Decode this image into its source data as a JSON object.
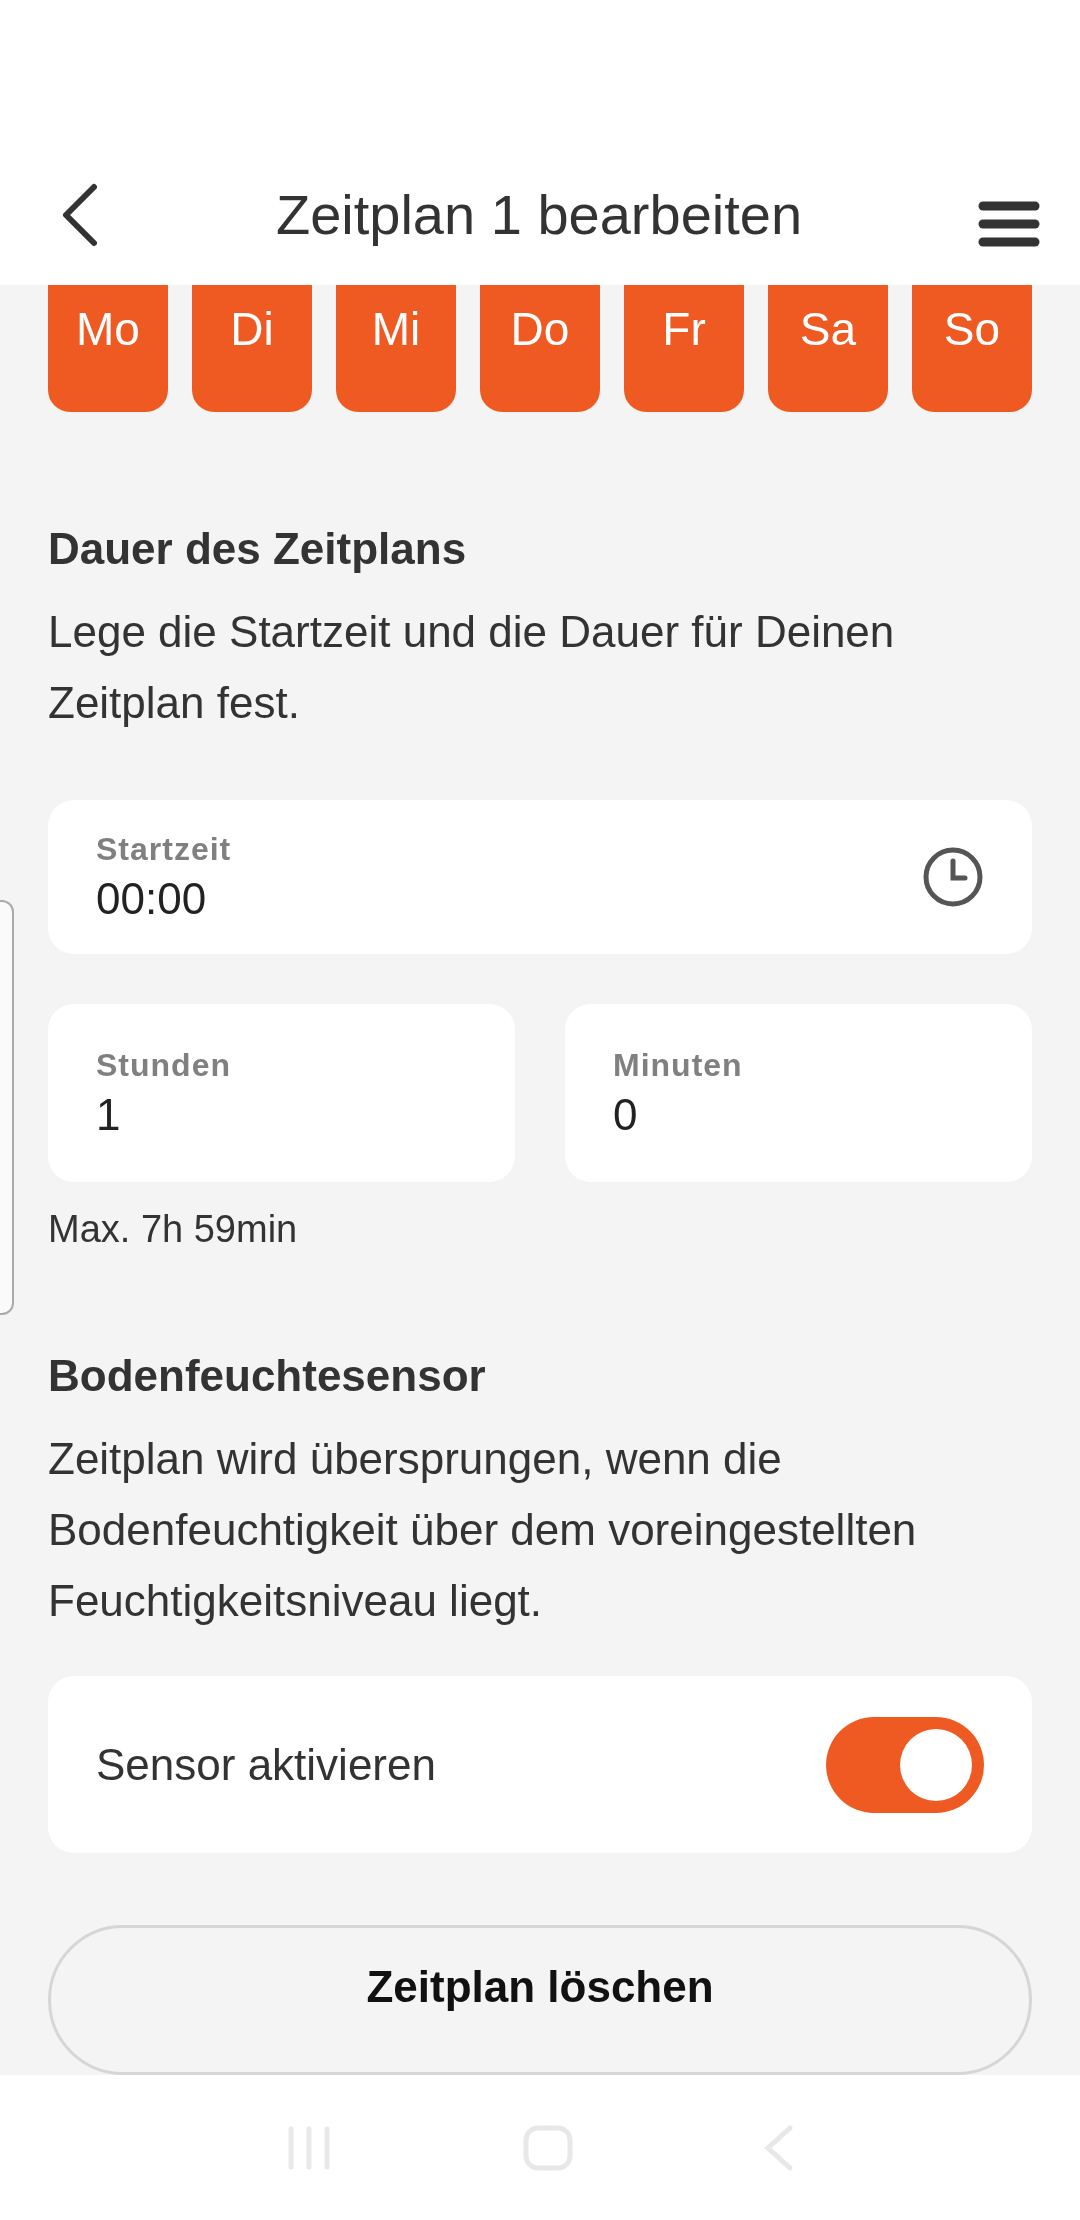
{
  "header": {
    "title": "Zeitplan 1 bearbeiten"
  },
  "days": [
    {
      "label": "Mo",
      "selected": true
    },
    {
      "label": "Di",
      "selected": true
    },
    {
      "label": "Mi",
      "selected": true
    },
    {
      "label": "Do",
      "selected": true
    },
    {
      "label": "Fr",
      "selected": true
    },
    {
      "label": "Sa",
      "selected": true
    },
    {
      "label": "So",
      "selected": true
    }
  ],
  "duration": {
    "heading": "Dauer des Zeitplans",
    "description": "Lege die Startzeit und die Dauer für Deinen Zeitplan fest.",
    "start": {
      "label": "Startzeit",
      "value": "00:00"
    },
    "hours": {
      "label": "Stunden",
      "value": "1"
    },
    "minutes": {
      "label": "Minuten",
      "value": "0"
    },
    "hint": "Max. 7h 59min"
  },
  "sensor": {
    "heading": "Bodenfeuchtesensor",
    "description": "Zeitplan wird übersprungen, wenn die Bodenfeuchtigkeit über dem voreingestellten Feuchtigkeitsniveau liegt.",
    "toggle_label": "Sensor aktivieren",
    "on": true
  },
  "delete_button": "Zeitplan löschen"
}
